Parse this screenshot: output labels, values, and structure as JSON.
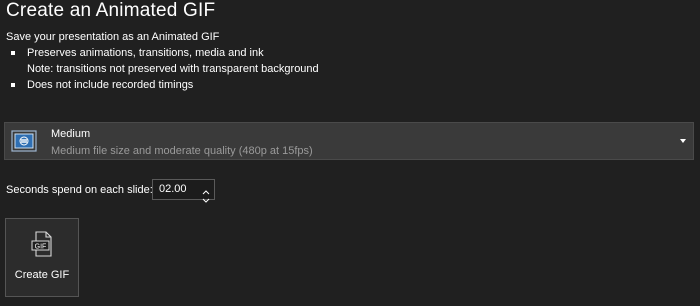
{
  "header": {
    "title": "Create an Animated GIF",
    "subtitle": "Save your presentation as an Animated GIF"
  },
  "bullets": [
    "Preserves animations, transitions, media and ink",
    "Does not include recorded timings"
  ],
  "note": "Note: transitions not preserved with transparent background",
  "quality": {
    "selected": "Medium",
    "description": "Medium file size and moderate quality (480p at 15fps)",
    "icon": "display-quality-icon"
  },
  "seconds": {
    "label": "Seconds spend on each slide:",
    "value": "02.00"
  },
  "create_button": {
    "label": "Create GIF",
    "icon": "gif-file-icon"
  }
}
